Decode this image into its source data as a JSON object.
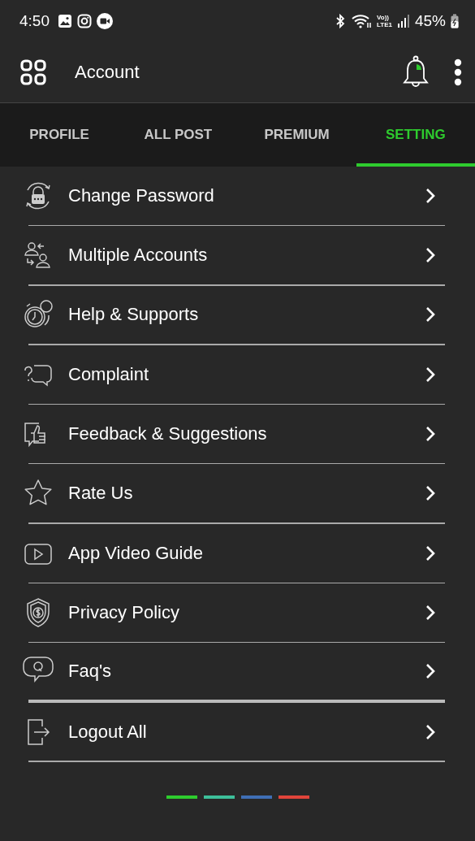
{
  "status_bar": {
    "time": "4:50",
    "volte_top": "Vo))",
    "volte_bottom": "LTE1",
    "battery": "45%"
  },
  "app_bar": {
    "title": "Account"
  },
  "tabs": [
    {
      "label": "PROFILE",
      "selected": false
    },
    {
      "label": "ALL POST",
      "selected": false
    },
    {
      "label": "PREMIUM",
      "selected": false
    },
    {
      "label": "SETTING",
      "selected": true
    }
  ],
  "menu": [
    {
      "label": "Change Password",
      "emphasized_divider": false
    },
    {
      "label": "Multiple Accounts",
      "emphasized_divider": false
    },
    {
      "label": "Help & Supports",
      "emphasized_divider": false
    },
    {
      "label": "Complaint",
      "emphasized_divider": false
    },
    {
      "label": "Feedback & Suggestions",
      "emphasized_divider": false
    },
    {
      "label": "Rate Us",
      "emphasized_divider": false
    },
    {
      "label": "App Video Guide",
      "emphasized_divider": false
    },
    {
      "label": "Privacy Policy",
      "emphasized_divider": false
    },
    {
      "label": "Faq's",
      "emphasized_divider": true
    },
    {
      "label": "Logout All",
      "emphasized_divider": false
    }
  ],
  "page_indicators": [
    {
      "color": "#2ecc2e"
    },
    {
      "color": "#3dbf9a"
    },
    {
      "color": "#3f6fb5"
    },
    {
      "color": "#e0443a"
    }
  ]
}
